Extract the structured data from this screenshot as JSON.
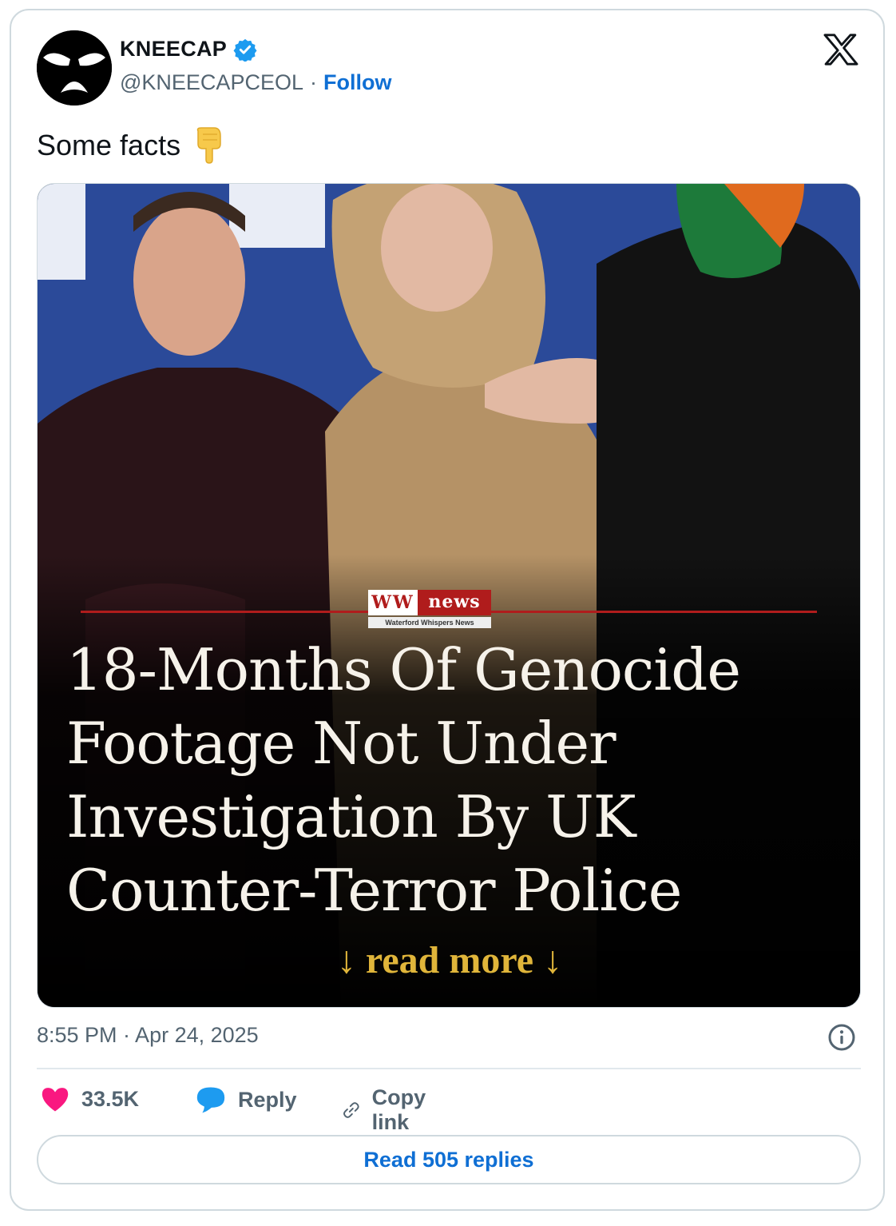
{
  "author": {
    "display_name": "KNEECAP",
    "handle": "@KNEECAPCEOL",
    "separator": "·",
    "follow_label": "Follow"
  },
  "tweet": {
    "text": "Some facts",
    "emoji": "backhand-index-pointing-down"
  },
  "media": {
    "brand_short": "WW",
    "brand_news": "news",
    "brand_full": "Waterford Whispers News",
    "headline": "18-Months Of Genocide\nFootage Not Under\nInvestigation By UK\nCounter-Terror Police",
    "read_more": "↓ read more ↓"
  },
  "timestamp": "8:55 PM · Apr 24, 2025",
  "actions": {
    "likes": "33.5K",
    "reply_label": "Reply",
    "copy_label": "Copy link"
  },
  "read_replies_label": "Read 505 replies",
  "colors": {
    "link_blue": "#0f6fd4",
    "like_pink": "#f91880",
    "reply_blue": "#1d9bf0",
    "brand_red": "#b01c1c",
    "read_more_gold": "#e0b53a"
  }
}
